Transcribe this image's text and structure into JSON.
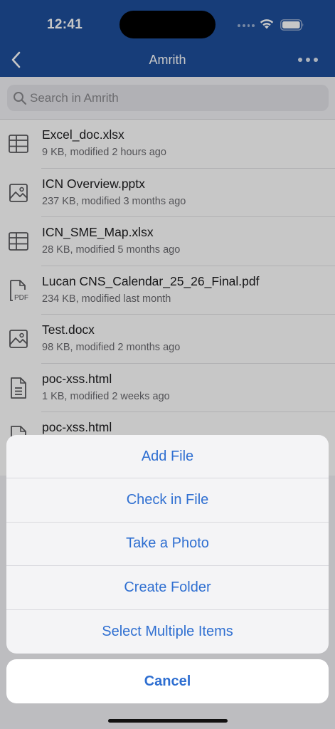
{
  "status_bar": {
    "time": "12:41"
  },
  "nav": {
    "title": "Amrith",
    "back_icon": "chevron-left-icon",
    "more_icon": "ellipsis-icon"
  },
  "search": {
    "placeholder": "Search in Amrith",
    "value": ""
  },
  "files": [
    {
      "name": "Excel_doc.xlsx",
      "meta": "9 KB, modified 2 hours ago",
      "icon": "spreadsheet-icon"
    },
    {
      "name": "ICN Overview.pptx",
      "meta": "237 KB, modified 3 months ago",
      "icon": "image-icon"
    },
    {
      "name": "ICN_SME_Map.xlsx",
      "meta": "28 KB, modified 5 months ago",
      "icon": "spreadsheet-icon"
    },
    {
      "name": "Lucan CNS_Calendar_25_26_Final.pdf",
      "meta": "234 KB, modified last month",
      "icon": "pdf-icon"
    },
    {
      "name": "Test.docx",
      "meta": "98 KB, modified 2 months ago",
      "icon": "image-icon"
    },
    {
      "name": "poc-xss.html",
      "meta": "1 KB, modified 2 weeks ago",
      "icon": "document-icon"
    },
    {
      "name": "poc-xss.html",
      "meta": "",
      "icon": "document-icon"
    }
  ],
  "action_sheet": {
    "items": [
      "Add File",
      "Check in File",
      "Take a Photo",
      "Create Folder",
      "Select Multiple Items"
    ],
    "cancel": "Cancel"
  },
  "colors": {
    "header": "#1e4f9c",
    "action_text": "#2f6fd1"
  }
}
